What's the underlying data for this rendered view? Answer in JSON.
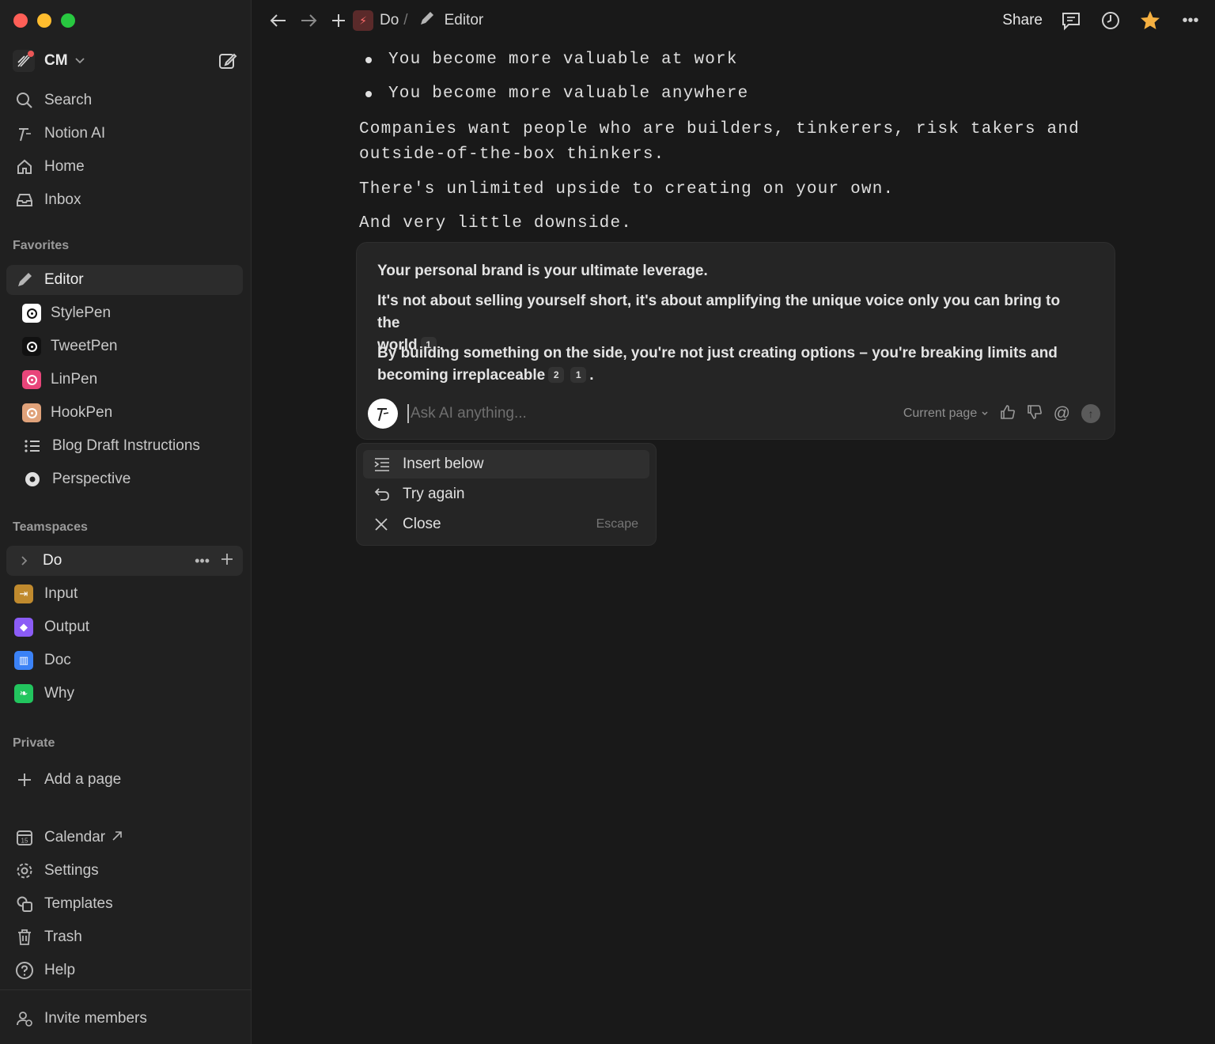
{
  "workspace": {
    "initials": "CM"
  },
  "nav": {
    "search": "Search",
    "notion_ai": "Notion AI",
    "home": "Home",
    "inbox": "Inbox"
  },
  "favorites": {
    "label": "Favorites",
    "items": [
      {
        "label": "Editor",
        "icon": "pencil-icon"
      },
      {
        "label": "StylePen",
        "icon": "target-icon",
        "color": "#ffffff"
      },
      {
        "label": "TweetPen",
        "icon": "target-icon",
        "color": "#111111"
      },
      {
        "label": "LinPen",
        "icon": "target-icon",
        "color": "#e8457a"
      },
      {
        "label": "HookPen",
        "icon": "target-icon",
        "color": "#e0a27a"
      },
      {
        "label": "Blog Draft Instructions",
        "icon": "list-icon"
      },
      {
        "label": "Perspective",
        "icon": "circle-icon"
      }
    ]
  },
  "teamspaces": {
    "label": "Teamspaces",
    "root": "Do",
    "items": [
      {
        "label": "Input",
        "icon": "inbox-icon",
        "color": "#c08a2e"
      },
      {
        "label": "Output",
        "icon": "gem-icon",
        "color": "#8b5cf6"
      },
      {
        "label": "Doc",
        "icon": "book-icon",
        "color": "#3b82f6"
      },
      {
        "label": "Why",
        "icon": "leaf-icon",
        "color": "#22c55e"
      }
    ]
  },
  "private": {
    "label": "Private",
    "add_page": "Add a page"
  },
  "bottom_nav": {
    "calendar": "Calendar",
    "calendar_day": "15",
    "settings": "Settings",
    "templates": "Templates",
    "trash": "Trash",
    "help": "Help",
    "invite": "Invite members"
  },
  "topbar": {
    "crumb_parent": "Do",
    "crumb_sep": "/",
    "crumb_current": "Editor",
    "share": "Share"
  },
  "editor": {
    "bullets": [
      "You become more valuable at work",
      "You become more valuable anywhere"
    ],
    "paragraphs": [
      "Companies want people who are builders, tinkerers, risk takers and",
      "outside-of-the-box thinkers.",
      "There's unlimited upside to creating on your own.",
      "And very little downside."
    ]
  },
  "ai_panel": {
    "line1": "Your personal brand is your ultimate leverage.",
    "line2a": "It's not about selling yourself short, it's about amplifying the unique voice only you can bring to the",
    "line2b": "world",
    "cite_a": "1",
    "line3a": "By building something on the side, you're not just creating options – you're breaking limits and",
    "line3b": "becoming irreplaceable",
    "cite_b": "2",
    "cite_c": "1",
    "period": ".",
    "placeholder": "Ask AI anything...",
    "scope": "Current page"
  },
  "menu": {
    "insert_below": "Insert below",
    "try_again": "Try again",
    "close": "Close",
    "close_shortcut": "Escape"
  }
}
